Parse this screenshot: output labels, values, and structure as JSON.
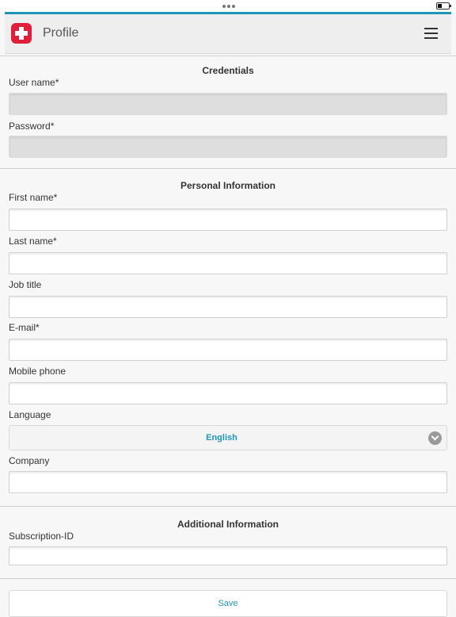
{
  "header": {
    "title": "Profile"
  },
  "sections": {
    "credentials": "Credentials",
    "personal": "Personal Information",
    "additional": "Additional Information"
  },
  "fields": {
    "username": {
      "label": "User name*",
      "value": ""
    },
    "password": {
      "label": "Password*",
      "value": ""
    },
    "first_name": {
      "label": "First name*",
      "value": ""
    },
    "last_name": {
      "label": "Last name*",
      "value": ""
    },
    "job_title": {
      "label": "Job title",
      "value": ""
    },
    "email": {
      "label": "E-mail*",
      "value": ""
    },
    "mobile": {
      "label": "Mobile phone",
      "value": ""
    },
    "language": {
      "label": "Language",
      "value": "English"
    },
    "company": {
      "label": "Company",
      "value": ""
    },
    "subscription": {
      "label": "Subscription-ID",
      "value": ""
    }
  },
  "actions": {
    "save_label": "Save"
  },
  "colors": {
    "accent": "#1f95b8",
    "brand": "#e0203a"
  },
  "icons": {
    "logo": "swiss-cross-icon",
    "menu": "hamburger-menu-icon",
    "select": "chevron-down-icon"
  }
}
